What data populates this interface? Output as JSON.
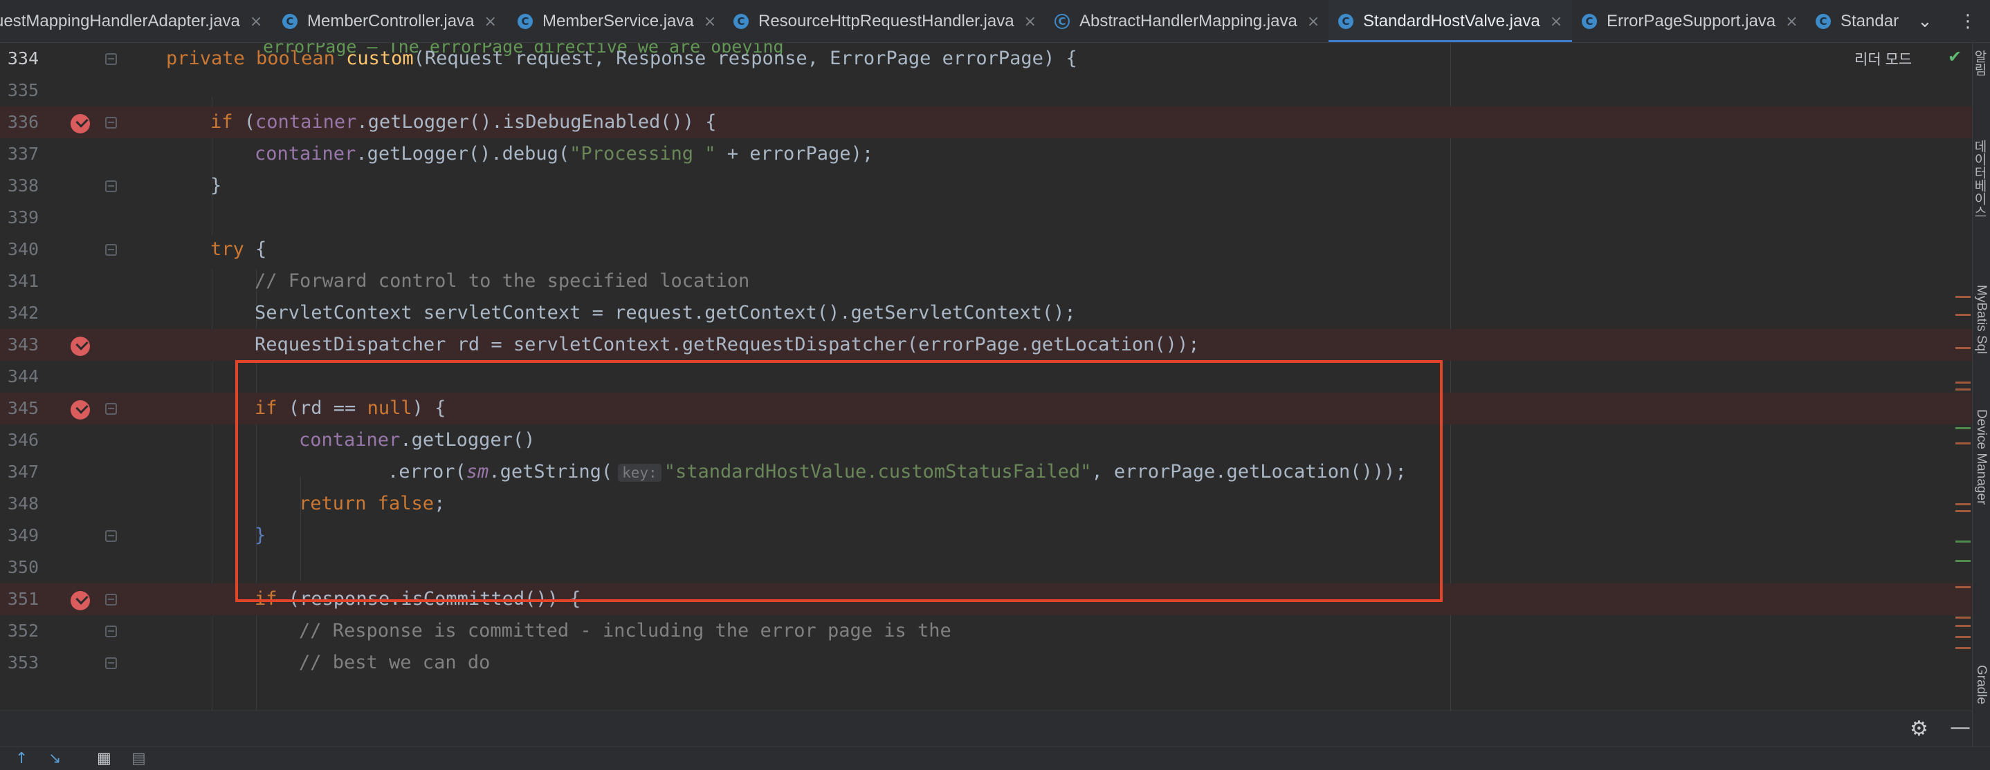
{
  "tabs": [
    {
      "label": "uestMappingHandlerAdapter.java",
      "icon": "class-icon",
      "active": false
    },
    {
      "label": "MemberController.java",
      "icon": "class-icon",
      "active": false
    },
    {
      "label": "MemberService.java",
      "icon": "class-icon",
      "active": false
    },
    {
      "label": "ResourceHttpRequestHandler.java",
      "icon": "class-icon",
      "active": false
    },
    {
      "label": "AbstractHandlerMapping.java",
      "icon": "abstract-class-icon",
      "active": false
    },
    {
      "label": "StandardHostValve.java",
      "icon": "class-icon",
      "active": true
    },
    {
      "label": "ErrorPageSupport.java",
      "icon": "class-icon",
      "active": false
    },
    {
      "label": "Standar",
      "icon": "class-icon",
      "active": false
    }
  ],
  "tab_icon_glyph": "C",
  "tab_close_glyph": "×",
  "tab_more": {
    "chevron": "⌄",
    "menu": "⋮"
  },
  "editor": {
    "reader_mode": "리더 모드",
    "doc_line": "errorPage – The errorPage directive we are obeying",
    "hint_key": "key:",
    "lines": {
      "l334": {
        "num": "334",
        "kw": "private boolean ",
        "fn": "custom",
        "rest": "(Request request, Response response, ErrorPage errorPage) {"
      },
      "l335": {
        "num": "335"
      },
      "l336": {
        "num": "336",
        "kw": "if ",
        "a": "(",
        "fld": "container",
        "rest": ".getLogger().isDebugEnabled()) {"
      },
      "l337": {
        "num": "337",
        "fld": "container",
        "mid": ".getLogger().debug(",
        "str": "\"Processing \"",
        "rest": " + errorPage);"
      },
      "l338": {
        "num": "338",
        "rest": "}"
      },
      "l339": {
        "num": "339"
      },
      "l340": {
        "num": "340",
        "kw": "try ",
        "rest": "{"
      },
      "l341": {
        "num": "341",
        "cm": "// Forward control to the specified location"
      },
      "l342": {
        "num": "342",
        "rest": "ServletContext servletContext = request.getContext().getServletContext();"
      },
      "l343": {
        "num": "343",
        "rest": "RequestDispatcher rd = servletContext.getRequestDispatcher(errorPage.getLocation());"
      },
      "l344": {
        "num": "344"
      },
      "l345": {
        "num": "345",
        "kw": "if ",
        "a": "(rd == ",
        "kw2": "null",
        "rest": ") {"
      },
      "l346": {
        "num": "346",
        "fld": "container",
        "rest": ".getLogger()"
      },
      "l347": {
        "num": "347",
        "a": ".error(",
        "fld": "sm",
        "mid": ".getString(",
        "str": "\"standardHostValue.customStatusFailed\"",
        "rest": ", errorPage.getLocation()));"
      },
      "l348": {
        "num": "348",
        "kw": "return false",
        "rest": ";"
      },
      "l349": {
        "num": "349",
        "rest": "}"
      },
      "l350": {
        "num": "350"
      },
      "l351": {
        "num": "351",
        "kw": "if ",
        "rest": "(response.isCommitted()) {"
      },
      "l352": {
        "num": "352",
        "cm": "// Response is committed - including the error page is the"
      },
      "l353": {
        "num": "353",
        "cm": "// best we can do"
      }
    }
  },
  "right_strip": [
    "알림",
    "데이터베이스",
    "MyBatis Sql",
    "Device Manager",
    "Gradle"
  ],
  "bottom": {
    "gear": "⚙",
    "minimize": "—"
  },
  "colors": {
    "accent": "#3d7dcc",
    "breakpoint": "#db5c5c",
    "highlight_box": "#e0452a",
    "breakpoint_line": "#3b2829"
  }
}
